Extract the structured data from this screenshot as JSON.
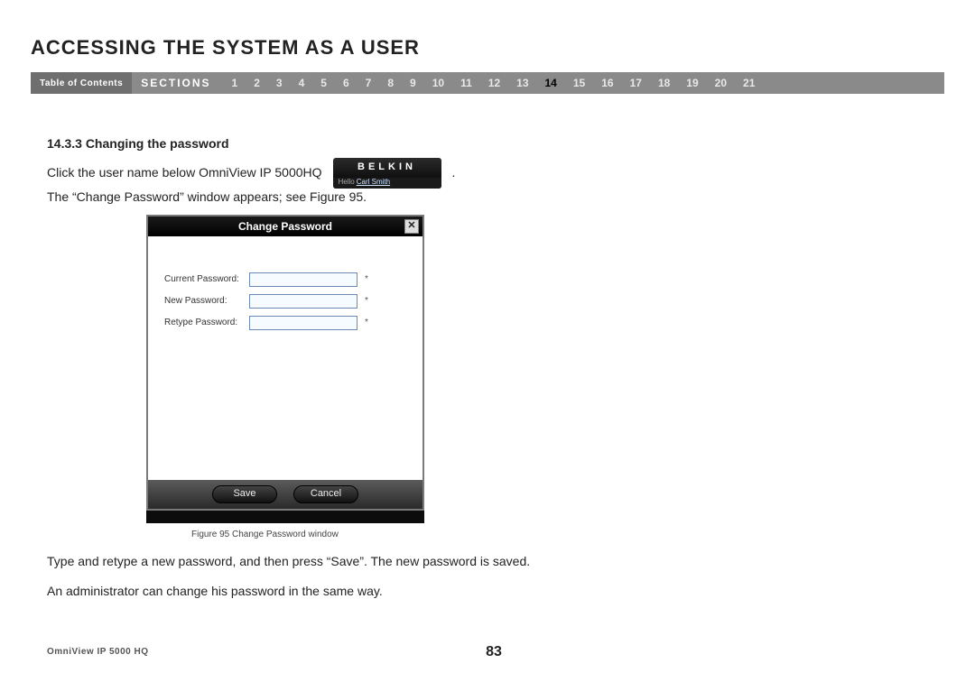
{
  "header": {
    "title": "ACCESSING THE SYSTEM AS A USER",
    "toc_label": "Table of Contents",
    "sections_label": "SECTIONS",
    "section_numbers": [
      "1",
      "2",
      "3",
      "4",
      "5",
      "6",
      "7",
      "8",
      "9",
      "10",
      "11",
      "12",
      "13",
      "14",
      "15",
      "16",
      "17",
      "18",
      "19",
      "20",
      "21"
    ],
    "active_section": "14"
  },
  "content": {
    "subheading": "14.3.3 Changing the password",
    "line1_before": "Click the user name below OmniView IP 5000HQ",
    "line1_after": ".",
    "line2": "The “Change Password” window appears; see Figure 95.",
    "belkin_brand": "BELKIN",
    "belkin_hello": "Hello",
    "belkin_user": "Carl Smith",
    "figure_caption": "Figure 95 Change Password window",
    "para2": "Type and retype a new password, and then press “Save”. The new password is saved.",
    "para3": "An administrator can change his password in the same way."
  },
  "dialog": {
    "title": "Change Password",
    "close": "✕",
    "fields": [
      {
        "label": "Current Password:",
        "required": "*"
      },
      {
        "label": "New Password:",
        "required": "*"
      },
      {
        "label": "Retype Password:",
        "required": "*"
      }
    ],
    "save_label": "Save",
    "cancel_label": "Cancel"
  },
  "footer": {
    "product": "OmniView IP 5000 HQ",
    "page": "83"
  }
}
